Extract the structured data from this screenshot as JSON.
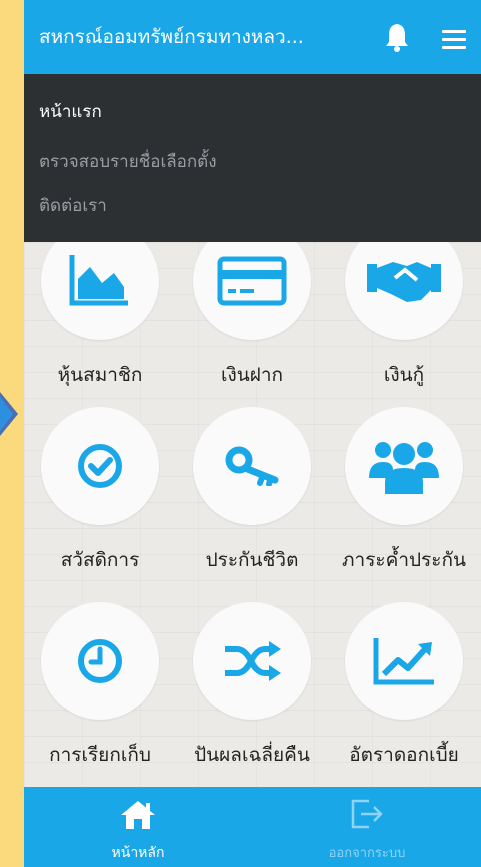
{
  "app": {
    "title": "สหกรณ์ออมทรัพย์กรมทางหลว..."
  },
  "header": {
    "bell_icon": "bell-icon",
    "menu_icon": "hamburger-menu-icon"
  },
  "menu": {
    "items": [
      {
        "label": "หน้าแรก",
        "active": true
      },
      {
        "label": "ตรวจสอบรายชื่อเลือกตั้ง",
        "active": false
      },
      {
        "label": "ติดต่อเรา",
        "active": false
      }
    ]
  },
  "tiles": [
    {
      "label": "หุ้นสมาชิก",
      "icon": "area-chart-icon"
    },
    {
      "label": "เงินฝาก",
      "icon": "credit-card-icon"
    },
    {
      "label": "เงินกู้",
      "icon": "handshake-icon"
    },
    {
      "label": "สวัสดิการ",
      "icon": "check-circle-icon"
    },
    {
      "label": "ประกันชีวิต",
      "icon": "key-icon"
    },
    {
      "label": "ภาระค้ำประกัน",
      "icon": "users-icon"
    },
    {
      "label": "การเรียกเก็บ",
      "icon": "clock-icon"
    },
    {
      "label": "ปันผลเฉลี่ยคืน",
      "icon": "shuffle-icon"
    },
    {
      "label": "อัตราดอกเบี้ย",
      "icon": "line-chart-icon"
    }
  ],
  "bottom_nav": [
    {
      "label": "หน้าหลัก",
      "icon": "home-icon",
      "active": true
    },
    {
      "label": "ออกจากระบบ",
      "icon": "logout-icon",
      "active": false
    }
  ],
  "colors": {
    "primary": "#1aa7e8",
    "dropdown_bg": "#2d3033",
    "page_bg": "#fbd97d",
    "icon": "#1aa7e8"
  }
}
